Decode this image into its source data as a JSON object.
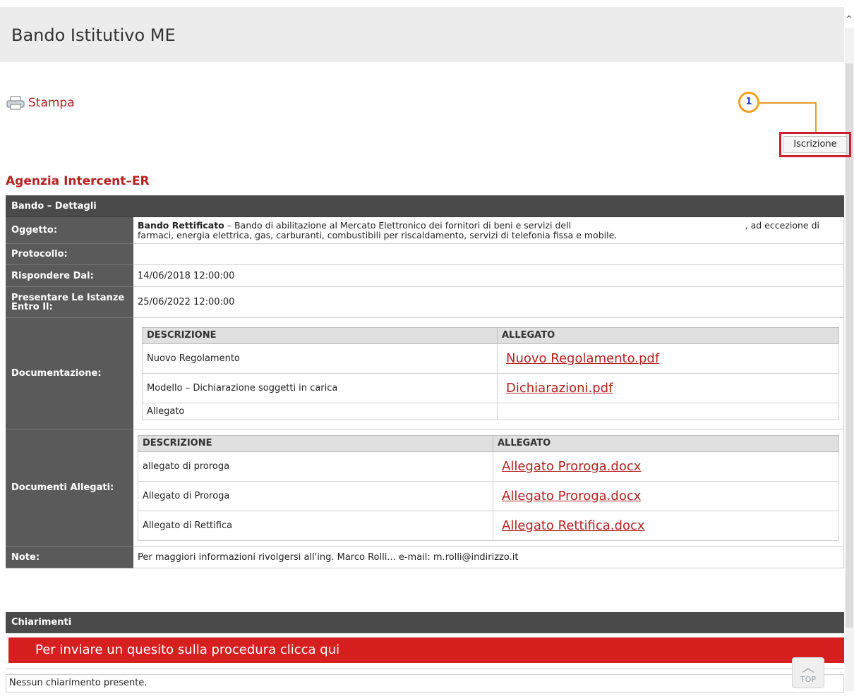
{
  "page": {
    "title": "Bando Istitutivo ME"
  },
  "toolbar": {
    "print_label": "Stampa",
    "iscrizione_label": "Iscrizione",
    "callout_number": "1"
  },
  "agency": "Agenzia Intercent–ER",
  "details": {
    "header": "Bando – Dettagli",
    "oggetto": {
      "label": "Oggetto:",
      "bold": "Bando Rettificato",
      "line1": " – Bando di abilitazione al Mercato Elettronico dei fornitori di beni e servizi dell",
      "line1_end": ", ad eccezione di",
      "line2": "farmaci, energia elettrica, gas, carburanti, combustibili per riscaldamento, servizi di telefonia fissa e mobile."
    },
    "protocollo": {
      "label": "Protocollo:",
      "value": ""
    },
    "rispondere": {
      "label": "Rispondere Dal:",
      "value": "14/06/2018 12:00:00"
    },
    "presentare": {
      "label": "Presentare Le Istanze Entro Il:",
      "value": "25/06/2022 12:00:00"
    },
    "documentazione": {
      "label": "Documentazione:",
      "col_desc": "DESCRIZIONE",
      "col_att": "ALLEGATO",
      "rows": [
        {
          "desc": "Nuovo Regolamento",
          "file": "Nuovo Regolamento.pdf"
        },
        {
          "desc": "Modello – Dichiarazione soggetti in carica",
          "file": "Dichiarazioni.pdf"
        },
        {
          "desc": "Allegato",
          "file": ""
        }
      ]
    },
    "allegati": {
      "label": "Documenti Allegati:",
      "col_desc": "DESCRIZIONE",
      "col_att": "ALLEGATO",
      "rows": [
        {
          "desc": "allegato di proroga",
          "file": "Allegato Proroga.docx"
        },
        {
          "desc": "Allegato di Proroga",
          "file": "Allegato Proroga.docx"
        },
        {
          "desc": "Allegato di Rettifica",
          "file": "Allegato Rettifica.docx"
        }
      ]
    },
    "note": {
      "label": "Note:",
      "value": "Per maggiori informazioni rivolgersi all'ing. Marco Rolli... e-mail: m.rolli@indirizzo.it"
    }
  },
  "chiarimenti": {
    "header": "Chiarimenti",
    "button": "Per inviare un quesito sulla procedura clicca qui",
    "empty": "Nessun chiarimento presente."
  },
  "top_label": "TOP"
}
